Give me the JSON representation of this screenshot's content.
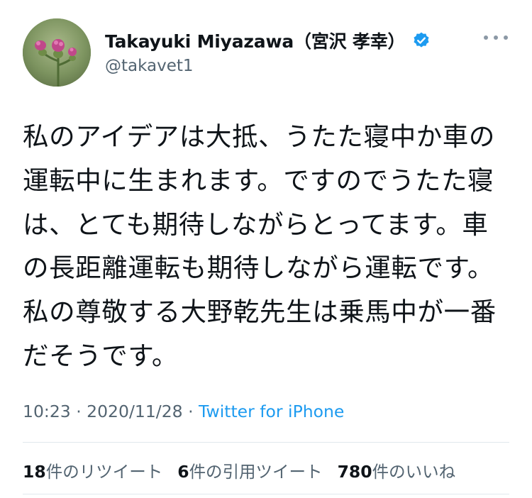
{
  "tweet": {
    "author": {
      "display_name": "Takayuki Miyazawa（宮沢 孝幸）",
      "handle": "@takavet1",
      "verified": true
    },
    "text": "私のアイデアは大抵、うたた寝中か車の運転中に生まれます。ですのでうたた寝は、とても期待しながらとってます。車の長距離運転も期待しながら運転です。私の尊敬する大野乾先生は乗馬中が一番だそうです。",
    "time": "10:23",
    "separator": " · ",
    "date": "2020/11/28",
    "source": "Twitter for iPhone"
  },
  "stats": {
    "retweets": {
      "count": "18",
      "label": "件のリツイート"
    },
    "quotes": {
      "count": "6",
      "label": "件の引用ツイート"
    },
    "likes": {
      "count": "780",
      "label": "件のいいね"
    }
  },
  "colors": {
    "verified_badge": "#1d9bf0",
    "secondary_text": "#536471",
    "link": "#1d9bf0"
  },
  "icons": {
    "verified": "verified-badge-icon",
    "more": "more-options-icon"
  }
}
